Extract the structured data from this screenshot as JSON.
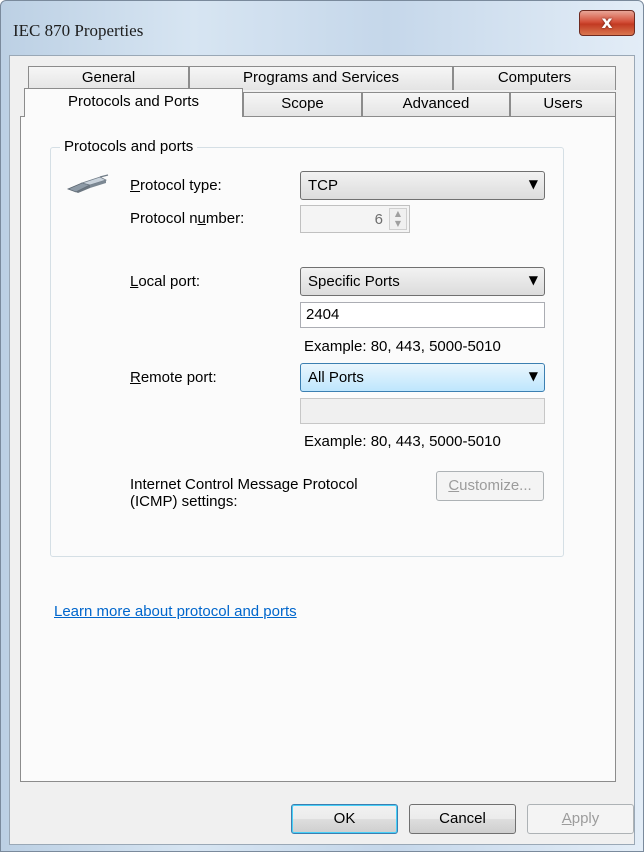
{
  "window": {
    "title": "IEC 870 Properties",
    "close_label": "x"
  },
  "tabs_row1": [
    "General",
    "Programs and Services",
    "Computers"
  ],
  "tabs_row2": [
    "Protocols and Ports",
    "Scope",
    "Advanced",
    "Users"
  ],
  "active_tab": "Protocols and Ports",
  "group_title": "Protocols and ports",
  "protocol_type": {
    "label_pre": "",
    "label_key": "P",
    "label_post": "rotocol type:",
    "value": "TCP"
  },
  "protocol_number": {
    "label_pre": "Protocol n",
    "label_key": "u",
    "label_post": "mber:",
    "value": "6"
  },
  "local_port": {
    "label_pre": "",
    "label_key": "L",
    "label_post": "ocal port:",
    "value": "Specific Ports",
    "entry": "2404",
    "example": "Example: 80, 443, 5000-5010"
  },
  "remote_port": {
    "label_pre": "",
    "label_key": "R",
    "label_post": "emote port:",
    "value": "All Ports",
    "entry": "",
    "example": "Example: 80, 443, 5000-5010"
  },
  "icmp": {
    "label_line1": "Internet Control Message Protocol",
    "label_line2": "(ICMP) settings:",
    "button_key": "C",
    "button_rest": "ustomize..."
  },
  "learn_more": "Learn more about protocol and ports",
  "buttons": {
    "ok": "OK",
    "cancel": "Cancel",
    "apply_key": "A",
    "apply_rest": "pply"
  },
  "icons": {
    "protocol": "network-cable-icon",
    "dropdown": "chevron-down-icon"
  }
}
